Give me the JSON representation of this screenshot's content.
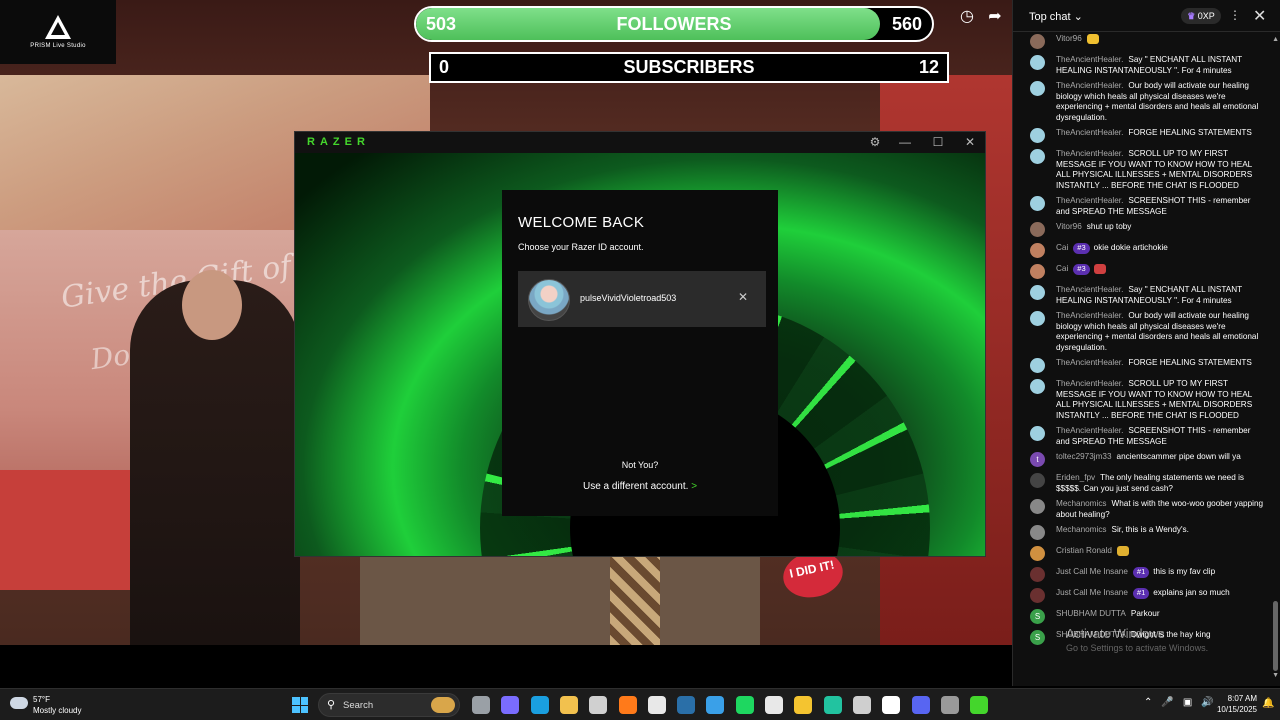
{
  "studio_logo": {
    "label": "PRISM Live Studio"
  },
  "overlay": {
    "followers": {
      "current": "503",
      "label": "FOLLOWERS",
      "goal": "560",
      "progress_fraction": 0.9
    },
    "subscribers": {
      "current": "0",
      "label": "SUBSCRIBERS",
      "goal": "12"
    }
  },
  "video_scene": {
    "wall_text_line1": "Give the Gift of Life",
    "wall_text_line2": "Donate Blood",
    "sticker_text": "I DID IT!"
  },
  "razer_window": {
    "brand": "RAZER",
    "title_buttons": {
      "settings_icon": "gear-icon",
      "minimize_icon": "minimize-icon",
      "maximize_icon": "maximize-icon",
      "close_icon": "close-icon"
    },
    "login": {
      "title": "WELCOME BACK",
      "subtitle": "Choose your Razer ID account.",
      "account_name": "pulseVividVioletroad503",
      "not_you": "Not You?",
      "use_different": "Use a different account.",
      "arrow": ">"
    }
  },
  "chat": {
    "header_title": "Top chat",
    "header_xp": "0XP",
    "messages": [
      {
        "author": "Vitor96",
        "text": "",
        "avatar_color": "#8a6a5a",
        "avatar_letter": "",
        "emoji_color": "#f0c030"
      },
      {
        "author": "TheAncientHealer.",
        "text": "Say \" ENCHANT ALL INSTANT HEALING INSTANTANEOUSLY \". For 4 minutes",
        "avatar_color": "#9ed0e0",
        "avatar_letter": ""
      },
      {
        "author": "TheAncientHealer.",
        "text": "Our body will activate our healing biology which heals all physical diseases we're experiencing + mental disorders and heals all emotional dysregulation.",
        "avatar_color": "#9ed0e0",
        "avatar_letter": ""
      },
      {
        "author": "TheAncientHealer.",
        "text": "FORGE HEALING STATEMENTS",
        "avatar_color": "#9ed0e0",
        "avatar_letter": ""
      },
      {
        "author": "TheAncientHealer.",
        "text": "SCROLL UP TO MY FIRST MESSAGE IF YOU WANT TO KNOW HOW TO HEAL ALL PHYSICAL ILLNESSES + MENTAL DISORDERS INSTANTLY ... BEFORE THE CHAT IS FLOODED",
        "avatar_color": "#9ed0e0",
        "avatar_letter": ""
      },
      {
        "author": "TheAncientHealer.",
        "text": "SCREENSHOT THIS - remember and SPREAD THE MESSAGE",
        "avatar_color": "#9ed0e0",
        "avatar_letter": ""
      },
      {
        "author": "Vitor96",
        "text": "shut up toby",
        "avatar_color": "#8a6a5a",
        "avatar_letter": ""
      },
      {
        "author": "Cai",
        "badge": "#3",
        "text": "okie dokie artichokie",
        "avatar_color": "#c08060",
        "avatar_letter": ""
      },
      {
        "author": "Cai",
        "badge": "#3",
        "text": "",
        "avatar_color": "#c08060",
        "avatar_letter": "",
        "emoji_color": "#d04040"
      },
      {
        "author": "TheAncientHealer.",
        "text": "Say \" ENCHANT ALL INSTANT HEALING INSTANTANEOUSLY \". For 4 minutes",
        "avatar_color": "#9ed0e0",
        "avatar_letter": ""
      },
      {
        "author": "TheAncientHealer.",
        "text": "Our body will activate our healing biology which heals all physical diseases we're experiencing + mental disorders and heals all emotional dysregulation.",
        "avatar_color": "#9ed0e0",
        "avatar_letter": ""
      },
      {
        "author": "TheAncientHealer.",
        "text": "FORGE HEALING STATEMENTS",
        "avatar_color": "#9ed0e0",
        "avatar_letter": ""
      },
      {
        "author": "TheAncientHealer.",
        "text": "SCROLL UP TO MY FIRST MESSAGE IF YOU WANT TO KNOW HOW TO HEAL ALL PHYSICAL ILLNESSES + MENTAL DISORDERS INSTANTLY ... BEFORE THE CHAT IS FLOODED",
        "avatar_color": "#9ed0e0",
        "avatar_letter": ""
      },
      {
        "author": "TheAncientHealer.",
        "text": "SCREENSHOT THIS - remember and SPREAD THE MESSAGE",
        "avatar_color": "#9ed0e0",
        "avatar_letter": ""
      },
      {
        "author": "toltec2973jm33",
        "text": "ancientscammer pipe down will ya",
        "avatar_color": "#7a4ab0",
        "avatar_letter": "t"
      },
      {
        "author": "Eriden_fpv",
        "text": "The only healing statements we need is $$$$$. Can you just send cash?",
        "avatar_color": "#444444",
        "avatar_letter": ""
      },
      {
        "author": "Mechanomics",
        "text": "What is with the woo-woo goober yapping about healing?",
        "avatar_color": "#888888",
        "avatar_letter": ""
      },
      {
        "author": "Mechanomics",
        "text": "Sir, this is a Wendy's.",
        "avatar_color": "#888888",
        "avatar_letter": ""
      },
      {
        "author": "Cristian Ronald",
        "text": "",
        "avatar_color": "#d09040",
        "avatar_letter": "",
        "emoji_color": "#e0b030"
      },
      {
        "author": "Just Call Me Insane",
        "badge": "#1",
        "text": "this is my fav clip",
        "avatar_color": "#6a3030",
        "avatar_letter": ""
      },
      {
        "author": "Just Call Me Insane",
        "badge": "#1",
        "text": "explains jan so much",
        "avatar_color": "#6a3030",
        "avatar_letter": ""
      },
      {
        "author": "SHUBHAM DUTTA",
        "text": "Parkour",
        "avatar_color": "#3aa04a",
        "avatar_letter": "S"
      },
      {
        "author": "SHUBHAM DUTTA",
        "text": "Dwight is the hay king",
        "avatar_color": "#3aa04a",
        "avatar_letter": "S"
      }
    ]
  },
  "watermark": {
    "line1": "Activate Windows",
    "line2": "Go to Settings to activate Windows."
  },
  "taskbar": {
    "weather_temp": "57°F",
    "weather_condition": "Mostly cloudy",
    "search_placeholder": "Search",
    "time": "8:07 AM",
    "date": "10/15/2025",
    "apps": [
      {
        "name": "task-view",
        "color": "#9aa0a6"
      },
      {
        "name": "copilot",
        "color": "#7a6cff"
      },
      {
        "name": "edge",
        "color": "#1a9fe0"
      },
      {
        "name": "file-explorer",
        "color": "#f2c14e"
      },
      {
        "name": "store",
        "color": "#d0d0d0"
      },
      {
        "name": "firefox",
        "color": "#ff7a1a"
      },
      {
        "name": "app-window",
        "color": "#e8e8e8"
      },
      {
        "name": "steam",
        "color": "#2a6fa8"
      },
      {
        "name": "app-blue",
        "color": "#3aa0e8"
      },
      {
        "name": "spotify",
        "color": "#1ed760"
      },
      {
        "name": "app-doc",
        "color": "#e8e8e8"
      },
      {
        "name": "chrome",
        "color": "#f4c430"
      },
      {
        "name": "app-wave",
        "color": "#22c3a0"
      },
      {
        "name": "app-grid",
        "color": "#cfcfcf"
      },
      {
        "name": "tiktok",
        "color": "#ffffff"
      },
      {
        "name": "discord",
        "color": "#5865f2"
      },
      {
        "name": "app-settings",
        "color": "#9a9a9a"
      },
      {
        "name": "razer",
        "color": "#44d62c"
      }
    ]
  }
}
